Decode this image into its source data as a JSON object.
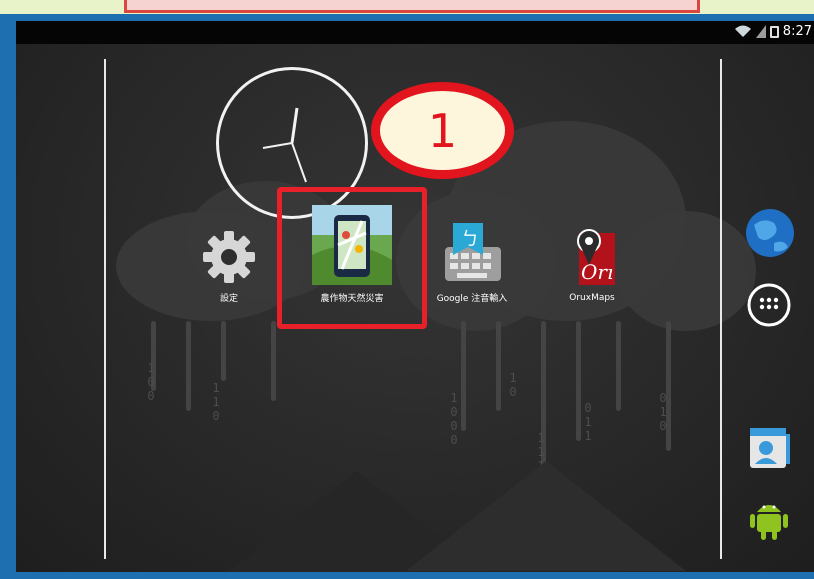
{
  "status_bar": {
    "time": "8:27"
  },
  "apps": [
    {
      "name": "settings",
      "label": "設定"
    },
    {
      "name": "crop-disaster",
      "label": "農作物天然災害"
    },
    {
      "name": "google-zhuyin",
      "label": "Google 注音輸入"
    },
    {
      "name": "oruxmaps",
      "label": "OruxMaps"
    }
  ],
  "annotation": {
    "step_number": "1"
  },
  "colors": {
    "frame": "#1d6fb0",
    "highlight": "#e8202a",
    "badge_fill": "#fdf6dc"
  }
}
